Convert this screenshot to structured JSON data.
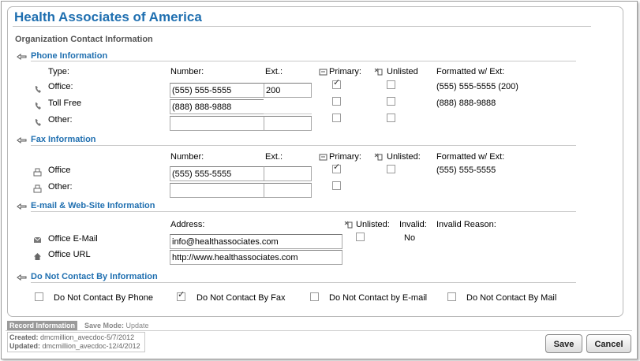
{
  "org_title": "Health Associates of America",
  "subtitle": "Organization Contact Information",
  "phone": {
    "heading": "Phone Information",
    "col_type": "Type:",
    "col_number": "Number:",
    "col_ext": "Ext.:",
    "col_primary": "Primary:",
    "col_unlisted": "Unlisted",
    "col_formatted": "Formatted w/ Ext:",
    "rows": [
      {
        "type": "Office:",
        "number": "(555) 555-5555",
        "ext": "200",
        "primary": true,
        "unlisted": false,
        "formatted": "(555) 555-5555 (200)"
      },
      {
        "type": "Toll Free",
        "number": "(888) 888-9888",
        "ext": "",
        "primary": false,
        "unlisted": false,
        "formatted": "(888) 888-9888"
      },
      {
        "type": "Other:",
        "number": "",
        "ext": "",
        "primary": false,
        "unlisted": false,
        "formatted": ""
      }
    ]
  },
  "fax": {
    "heading": "Fax Information",
    "col_number": "Number:",
    "col_ext": "Ext.:",
    "col_primary": "Primary:",
    "col_unlisted": "Unlisted:",
    "col_formatted": "Formatted w/ Ext:",
    "rows": [
      {
        "type": "Office",
        "number": "(555) 555-5555",
        "ext": "",
        "primary": true,
        "unlisted": false,
        "formatted": "(555) 555-5555"
      },
      {
        "type": "Other:",
        "number": "",
        "ext": "",
        "primary": false,
        "formatted": ""
      }
    ]
  },
  "email": {
    "heading": "E-mail & Web-Site Information",
    "col_address": "Address:",
    "col_unlisted": "Unlisted:",
    "col_invalid": "Invalid:",
    "col_invalid_reason": "Invalid Reason:",
    "rows": [
      {
        "type": "Office E-Mail",
        "address": "info@healthassociates.com",
        "unlisted": false,
        "invalid": "No"
      },
      {
        "type": "Office URL",
        "address": "http://www.healthassociates.com"
      }
    ]
  },
  "dnc": {
    "heading": "Do Not Contact By Information",
    "options": [
      {
        "label": "Do Not Contact By Phone",
        "checked": false
      },
      {
        "label": "Do Not Contact By Fax",
        "checked": true
      },
      {
        "label": "Do Not Contact by E-mail",
        "checked": false
      },
      {
        "label": "Do Not Contact By Mail",
        "checked": false
      }
    ]
  },
  "record": {
    "tab_label": "Record Information",
    "save_mode_label": "Save Mode:",
    "save_mode_value": "Update",
    "created_label": "Created:",
    "created_value": "dmcmillion_avecdoc-5/7/2012",
    "updated_label": "Updated:",
    "updated_value": "dmcmillion_avecdoc-12/4/2012"
  },
  "buttons": {
    "save": "Save",
    "cancel": "Cancel"
  },
  "colors": {
    "accent": "#1f6fb0",
    "border": "#b8b8b8"
  }
}
